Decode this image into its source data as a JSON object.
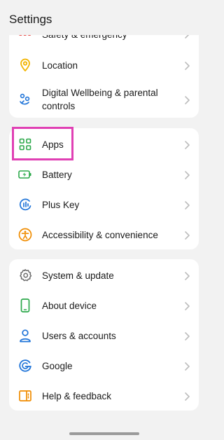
{
  "header": {
    "title": "Settings"
  },
  "card1": {
    "items": [
      {
        "label": "Safety & emergency",
        "icon": "sos-icon"
      },
      {
        "label": "Location",
        "icon": "location-pin-icon"
      },
      {
        "label": "Digital Wellbeing & parental controls",
        "line1": "Digital Wellbeing & parental",
        "line2": "controls",
        "icon": "wellbeing-icon"
      }
    ]
  },
  "card2": {
    "items": [
      {
        "label": "Apps",
        "icon": "apps-grid-icon"
      },
      {
        "label": "Battery",
        "icon": "battery-icon"
      },
      {
        "label": "Plus Key",
        "icon": "plus-key-icon"
      },
      {
        "label": "Accessibility & convenience",
        "icon": "accessibility-icon"
      }
    ]
  },
  "card3": {
    "items": [
      {
        "label": "System & update",
        "icon": "gear-icon"
      },
      {
        "label": "About device",
        "icon": "phone-icon"
      },
      {
        "label": "Users & accounts",
        "icon": "user-icon"
      },
      {
        "label": "Google",
        "icon": "google-icon"
      },
      {
        "label": "Help & feedback",
        "icon": "help-icon"
      }
    ]
  },
  "sos_text": "SOS",
  "colors": {
    "highlight": "#e040b4",
    "sos": "#e53935",
    "location": "#f2b400",
    "wellbeing": "#1e73d8",
    "apps": "#2ba84a",
    "battery": "#2ba84a",
    "plus_key": "#1e73d8",
    "accessibility": "#f08c00",
    "gear": "#6b6b6b",
    "about": "#2ba84a",
    "user": "#1e73d8",
    "google": "#1e73d8",
    "help": "#f08c00"
  }
}
